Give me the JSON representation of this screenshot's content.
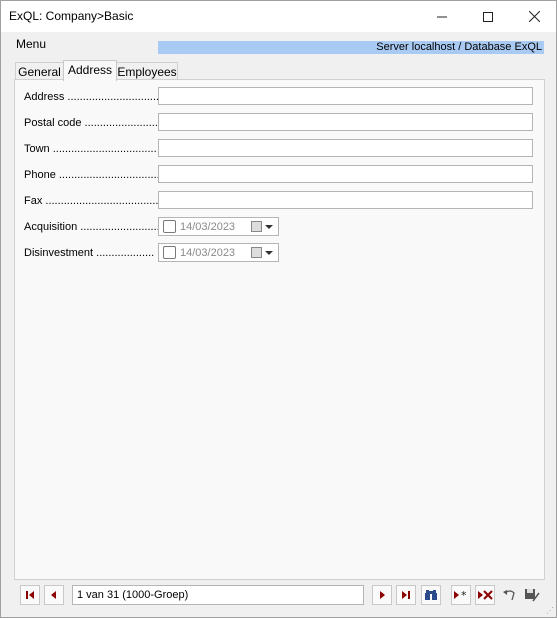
{
  "window": {
    "title": "ExQL: Company>Basic"
  },
  "menubar": {
    "menu_label": "Menu",
    "server_info": "Server localhost / Database ExQL"
  },
  "tabs": [
    {
      "label": "General",
      "active": false
    },
    {
      "label": "Address",
      "active": true
    },
    {
      "label": "Employees",
      "active": false
    }
  ],
  "form": {
    "fields": [
      {
        "label": "Address ..............................",
        "value": ""
      },
      {
        "label": "Postal code ........................",
        "value": ""
      },
      {
        "label": "Town ..................................",
        "value": ""
      },
      {
        "label": "Phone .................................",
        "value": ""
      },
      {
        "label": "Fax ......................................",
        "value": ""
      }
    ],
    "dates": [
      {
        "label": "Acquisition ..........................",
        "value": "14/03/2023",
        "checked": false
      },
      {
        "label": "Disinvestment ...................",
        "value": "14/03/2023",
        "checked": false
      }
    ]
  },
  "navigation": {
    "record_text": "1 van 31 (1000-Groep)"
  },
  "colors": {
    "accent": "#a9caf3",
    "nav_red": "#8b0000"
  }
}
